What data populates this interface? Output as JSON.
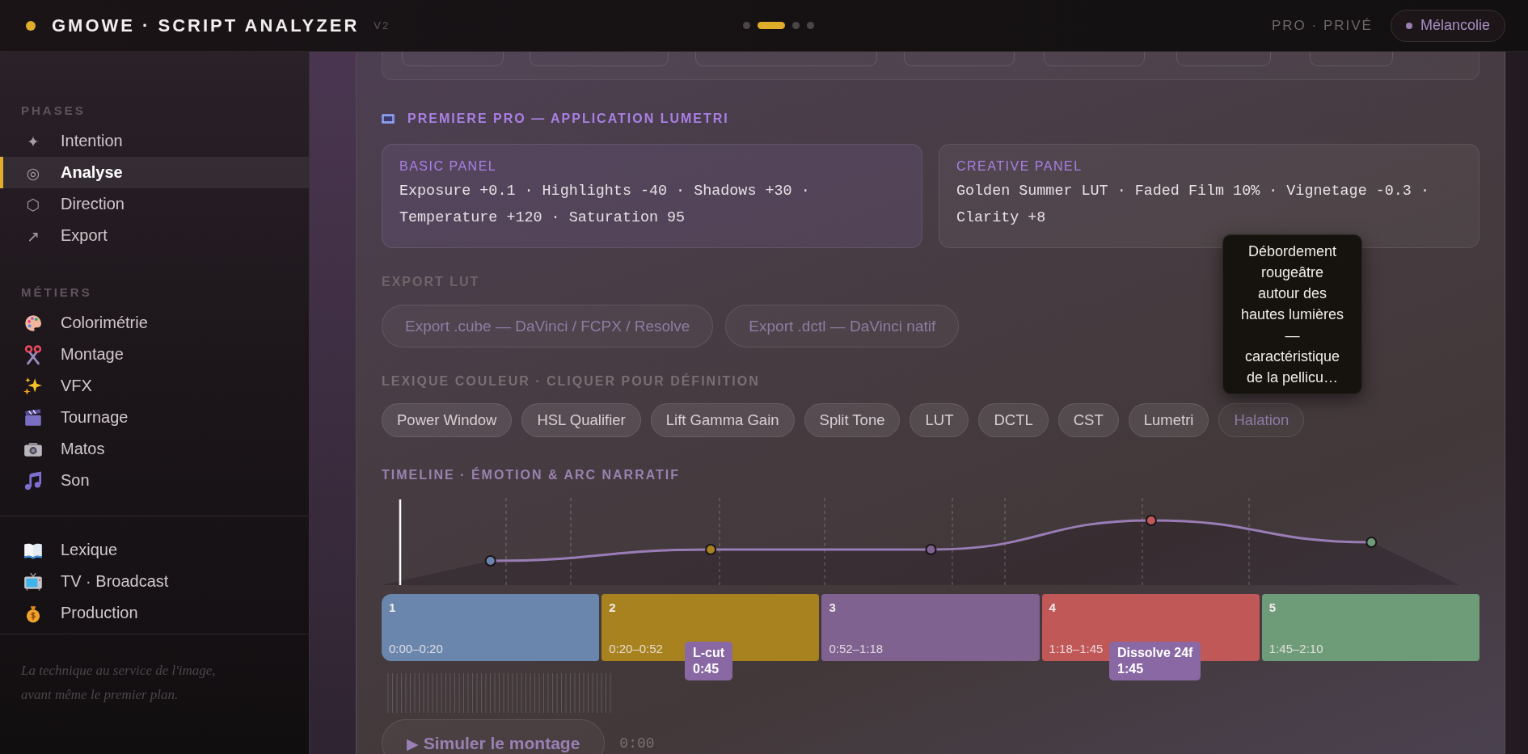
{
  "app": {
    "title": "GMOWE · SCRIPT ANALYZER",
    "version": "V2",
    "steps": [
      {
        "selected": false
      },
      {
        "selected": true
      },
      {
        "selected": false
      },
      {
        "selected": false
      }
    ],
    "plan": "PRO · PRIVÉ",
    "mood": {
      "label": "Mélancolie",
      "color": "#9a7fb4"
    }
  },
  "sidebar": {
    "sections": [
      {
        "heading": "PHASES",
        "items": [
          {
            "icon": "✦",
            "label": "Intention",
            "selected": false
          },
          {
            "icon": "◎",
            "label": "Analyse",
            "selected": true
          },
          {
            "icon": "⬡",
            "label": "Direction",
            "selected": false
          },
          {
            "icon": "↗",
            "label": "Export",
            "selected": false
          }
        ]
      },
      {
        "heading": "MÉTIERS",
        "items": [
          {
            "label": "Colorimétrie",
            "selected": false
          },
          {
            "label": "Montage",
            "selected": false
          },
          {
            "label": "VFX",
            "selected": false
          },
          {
            "label": "Tournage",
            "selected": false
          },
          {
            "label": "Matos",
            "selected": false
          },
          {
            "label": "Son",
            "selected": false
          }
        ]
      },
      {
        "items": [
          {
            "label": "Lexique",
            "selected": false
          },
          {
            "label": "TV · Broadcast",
            "selected": false
          },
          {
            "label": "Production",
            "selected": false
          }
        ]
      }
    ],
    "tagline": [
      "La technique au service de l'image,",
      "avant même le premier plan."
    ]
  },
  "lumetri": {
    "heading": "PREMIERE PRO — APPLICATION LUMETRI",
    "panels": [
      {
        "title": "BASIC PANEL",
        "text": "Exposure +0.1 · Highlights -40 · Shadows +30 · Temperature +120 · Saturation 95"
      },
      {
        "title": "CREATIVE PANEL",
        "text": "Golden Summer LUT · Faded Film 10% · Vignetage -0.3 · Clarity +8"
      }
    ]
  },
  "export_lut": {
    "heading": "EXPORT LUT",
    "buttons": [
      "Export .cube — DaVinci / FCPX / Resolve",
      "Export .dctl — DaVinci natif"
    ]
  },
  "lexicon": {
    "heading": "LEXIQUE COULEUR · CLIQUER POUR DÉFINITION",
    "chips": [
      {
        "label": "Power Window",
        "selected": false
      },
      {
        "label": "HSL Qualifier",
        "selected": false
      },
      {
        "label": "Lift Gamma Gain",
        "selected": false
      },
      {
        "label": "Split Tone",
        "selected": false
      },
      {
        "label": "LUT",
        "selected": false
      },
      {
        "label": "DCTL",
        "selected": false
      },
      {
        "label": "CST",
        "selected": false
      },
      {
        "label": "Lumetri",
        "selected": false
      },
      {
        "label": "Halation",
        "selected": true
      }
    ],
    "tooltip": "Débordement rougeâtre autour des hautes lumières — caractéristique de la pellicu…"
  },
  "timeline": {
    "heading": "TIMELINE · ÉMOTION & ARC NARRATIF",
    "segments": [
      {
        "number": "1",
        "range": "0:00–0:20",
        "color": "#6b86ad"
      },
      {
        "number": "2",
        "range": "0:20–0:52",
        "color": "#a8821f"
      },
      {
        "number": "3",
        "range": "0:52–1:18",
        "color": "#7f6290"
      },
      {
        "number": "4",
        "range": "1:18–1:45",
        "color": "#c05858"
      },
      {
        "number": "5",
        "range": "1:45–2:10",
        "color": "#6e9b78"
      }
    ],
    "transitions": [
      {
        "label": "L-cut",
        "time": "0:45"
      },
      {
        "label": "Dissolve 24f",
        "time": "1:45"
      }
    ],
    "play_button": {
      "icon": "▶",
      "label": "Simuler le montage"
    },
    "clock": "0:00"
  }
}
